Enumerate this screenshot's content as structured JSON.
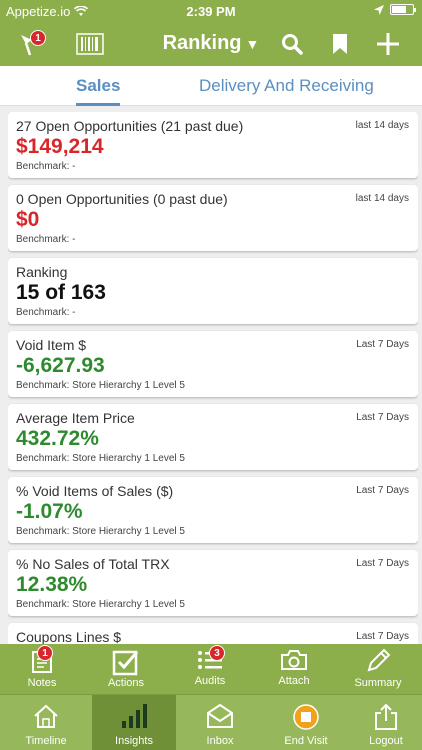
{
  "status_bar": {
    "carrier": "Appetize.io",
    "time": "2:39 PM"
  },
  "nav": {
    "title": "Ranking",
    "notification_badge": "1"
  },
  "tabs": [
    {
      "label": "Sales"
    },
    {
      "label": "Delivery And Receiving"
    }
  ],
  "cards": [
    {
      "title": "27 Open Opportunities (21 past due)",
      "period": "last 14 days",
      "value": "$149,214",
      "value_color": "red",
      "benchmark": "Benchmark: -"
    },
    {
      "title": "0 Open Opportunities (0 past due)",
      "period": "last 14 days",
      "value": "$0",
      "value_color": "red",
      "benchmark": "Benchmark: -"
    },
    {
      "title": "Ranking",
      "period": "",
      "value": "15 of 163",
      "value_color": "black",
      "benchmark": "Benchmark: -"
    },
    {
      "title": "Void Item $",
      "period": "Last 7 Days",
      "value": "-6,627.93",
      "value_color": "green",
      "benchmark": "Benchmark: Store Hierarchy 1 Level 5"
    },
    {
      "title": "Average Item Price",
      "period": "Last 7 Days",
      "value": "432.72%",
      "value_color": "green",
      "benchmark": "Benchmark: Store Hierarchy 1 Level 5"
    },
    {
      "title": "% Void Items of Sales ($)",
      "period": "Last 7 Days",
      "value": "-1.07%",
      "value_color": "green",
      "benchmark": "Benchmark: Store Hierarchy 1 Level 5"
    },
    {
      "title": "% No Sales of Total TRX",
      "period": "Last 7 Days",
      "value": "12.38%",
      "value_color": "green",
      "benchmark": "Benchmark: Store Hierarchy 1 Level 5"
    },
    {
      "title": "Coupons Lines $",
      "period": "Last 7 Days",
      "value": "",
      "value_color": "green",
      "benchmark": ""
    }
  ],
  "action_bar": {
    "notes": {
      "label": "Notes",
      "badge": "1"
    },
    "actions": {
      "label": "Actions"
    },
    "audits": {
      "label": "Audits",
      "badge": "3"
    },
    "attach": {
      "label": "Attach"
    },
    "summary": {
      "label": "Summary"
    }
  },
  "tab_bar": {
    "timeline": "Timeline",
    "insights": "Insights",
    "inbox": "Inbox",
    "end_visit": "End Visit",
    "logout": "Logout"
  },
  "colors": {
    "brand_green": "#8cae4b",
    "tab_blue": "#5b8fbf",
    "red": "#d9262a",
    "green": "#2e8a2e",
    "end_visit_orange": "#f0a21c"
  }
}
